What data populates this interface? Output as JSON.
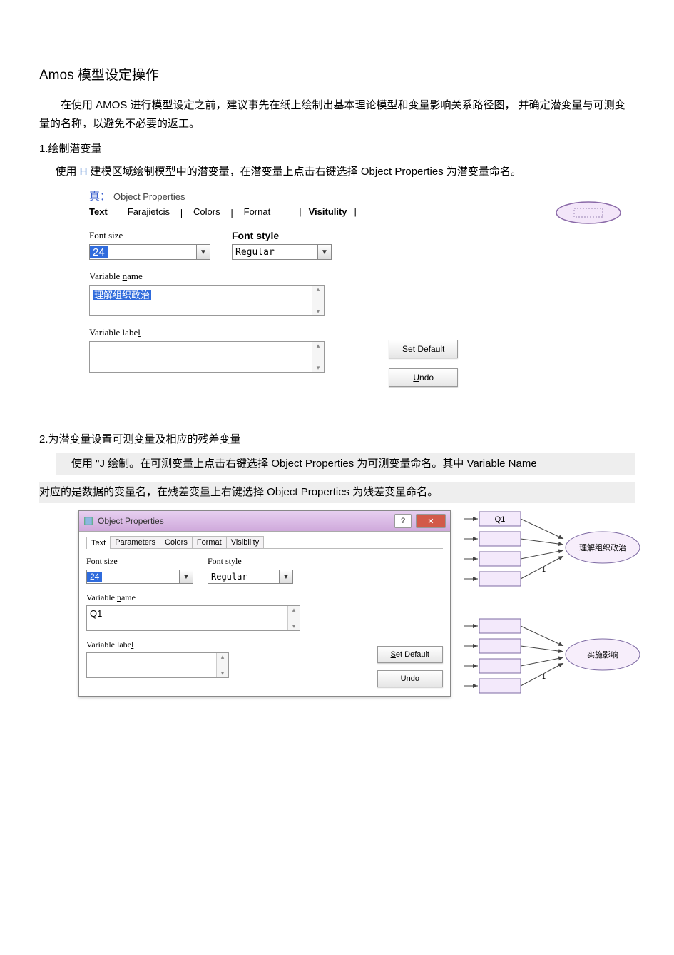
{
  "doc": {
    "title": "Amos 模型设定操作",
    "intro": "在使用 AMOS 进行模型设定之前，建议事先在纸上绘制出基本理论模型和变量影响关系路径图，   并确定潜变量与可测变量的名称，以避免不必要的返工。",
    "sec1_title": "1.绘制潜变量",
    "sec1_body_a": "使用 ",
    "sec1_body_h": "H",
    "sec1_body_b": " 建模区域绘制模型中的潜变量，在潜变量上点击右键选择  Object Properties 为潜变量命名。",
    "sec2_title": "2.为潜变量设置可测变量及相应的残差变量",
    "sec2_line1_a": "使用   \"",
    "sec2_line1_j": "J",
    "sec2_line1_b": " 绘制。在可测变量上点击右键选择  Object Properties 为可测变量命名。其中 Variable Name",
    "sec2_line2": "对应的是数据的变量名，在残差变量上右键选择     Object Properties 为残差变量命名。"
  },
  "dlg1": {
    "top_prefix": "真：",
    "top_title": "Object Properties",
    "tabs": {
      "text": "Text",
      "parameters": "Farajietcis",
      "colors": "Colors",
      "format": "Fornat",
      "visibility": "Visitulity"
    },
    "font_size_label": "Font size",
    "font_style_label": "Font style",
    "font_size_value": "24",
    "font_style_value": "Regular",
    "var_name_label": "Variable  name",
    "var_name_value": "理解组织政治",
    "var_label_label": "Variable  label",
    "var_label_value": "",
    "set_default": "Set Default",
    "undo": "Undo"
  },
  "dlg2": {
    "title": "Object Properties",
    "tabs": {
      "text": "Text",
      "parameters": "Parameters",
      "colors": "Colors",
      "format": "Format",
      "visibility": "Visibility"
    },
    "font_size_label": "Font size",
    "font_style_label": "Font style",
    "font_size_value": "24",
    "font_style_value": "Regular",
    "var_name_label": "Variable  name",
    "var_name_value": "Q1",
    "var_label_label": "Variable  label",
    "var_label_value": "",
    "set_default": "Set Default",
    "undo": "Undo"
  },
  "diagram": {
    "top_var": "Q1",
    "latent1": "理解组织政治",
    "latent2": "实施影响",
    "edge_label": "1"
  }
}
